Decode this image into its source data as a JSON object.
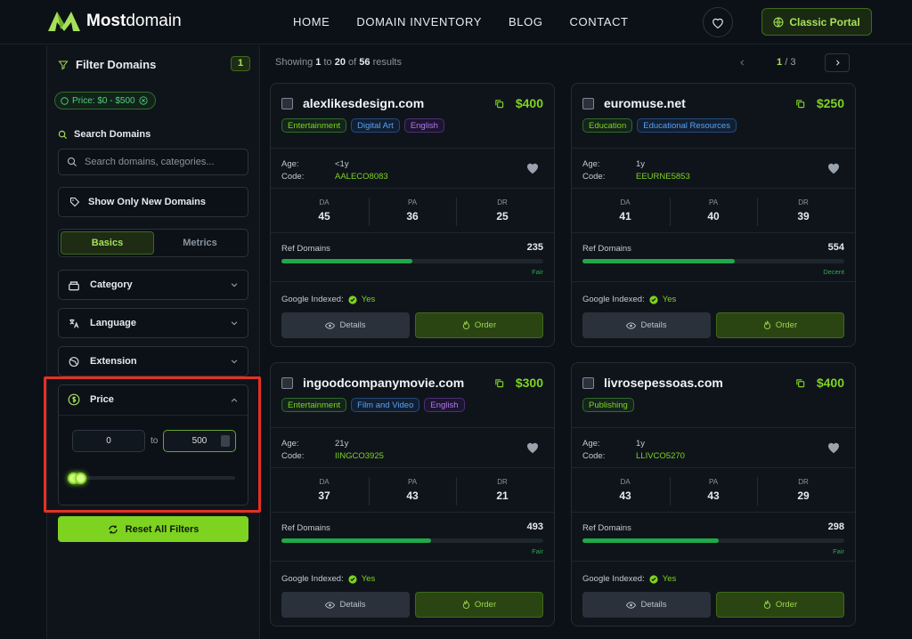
{
  "brand": {
    "name_bold": "Most",
    "name_rest": "domain"
  },
  "nav": {
    "items": [
      "HOME",
      "DOMAIN INVENTORY",
      "BLOG",
      "CONTACT"
    ],
    "portal_label": "Classic Portal"
  },
  "sidebar": {
    "title": "Filter Domains",
    "active_filter_count": "1",
    "price_chip": "Price: $0 - $500",
    "search_label": "Search Domains",
    "search_placeholder": "Search domains, categories...",
    "new_domains_label": "Show Only New Domains",
    "tabs": [
      "Basics",
      "Metrics"
    ],
    "active_tab": "Basics",
    "accordions": [
      "Category",
      "Language",
      "Extension"
    ],
    "price": {
      "label": "Price",
      "min": "0",
      "to_label": "to",
      "max": "500",
      "slider_min_fraction": 0,
      "slider_max_fraction": 0
    },
    "reset_label": "Reset All Filters"
  },
  "results": {
    "prefix": "Showing",
    "from": "1",
    "to_word": "to",
    "to": "20",
    "of_word": "of",
    "total": "56",
    "suffix": "results"
  },
  "pager": {
    "current": "1",
    "sep": "/",
    "total": "3"
  },
  "card_labels": {
    "age": "Age:",
    "code": "Code:",
    "da": "DA",
    "pa": "PA",
    "dr": "DR",
    "ref_domains": "Ref Domains",
    "google_indexed": "Google Indexed:",
    "details": "Details",
    "order": "Order"
  },
  "cards": [
    {
      "domain": "alexlikesdesign.com",
      "price": "$400",
      "tags": [
        {
          "label": "Entertainment",
          "color": "green"
        },
        {
          "label": "Digital Art",
          "color": "blue"
        },
        {
          "label": "English",
          "color": "purple"
        }
      ],
      "age": "<1y",
      "code": "AALECO8083",
      "da": "45",
      "pa": "36",
      "dr": "25",
      "ref_domains": "235",
      "ref_fraction": 0.5,
      "quality": "Fair",
      "indexed": "Yes"
    },
    {
      "domain": "euromuse.net",
      "price": "$250",
      "tags": [
        {
          "label": "Education",
          "color": "green"
        },
        {
          "label": "Educational Resources",
          "color": "blue"
        }
      ],
      "age": "1y",
      "code": "EEURNE5853",
      "da": "41",
      "pa": "40",
      "dr": "39",
      "ref_domains": "554",
      "ref_fraction": 0.58,
      "quality": "Decent",
      "indexed": "Yes"
    },
    {
      "domain": "ingoodcompanymovie.com",
      "price": "$300",
      "tags": [
        {
          "label": "Entertainment",
          "color": "green"
        },
        {
          "label": "Film and Video",
          "color": "blue"
        },
        {
          "label": "English",
          "color": "purple"
        }
      ],
      "age": "21y",
      "code": "IINGCO3925",
      "da": "37",
      "pa": "43",
      "dr": "21",
      "ref_domains": "493",
      "ref_fraction": 0.57,
      "quality": "Fair",
      "indexed": "Yes"
    },
    {
      "domain": "livrosepessoas.com",
      "price": "$400",
      "tags": [
        {
          "label": "Publishing",
          "color": "green"
        }
      ],
      "age": "1y",
      "code": "LLIVCO5270",
      "da": "43",
      "pa": "43",
      "dr": "29",
      "ref_domains": "298",
      "ref_fraction": 0.52,
      "quality": "Fair",
      "indexed": "Yes"
    }
  ],
  "colors": {
    "accent": "#7ed321",
    "background": "#0c1117",
    "highlight": "#e53025"
  },
  "icons": [
    "logo-mark-icon",
    "heart-icon",
    "globe-icon",
    "filter-icon",
    "search-icon",
    "tag-icon",
    "layers-icon",
    "translate-icon",
    "globe-ext-icon",
    "dollar-icon",
    "chevron-down-icon",
    "chevron-up-icon",
    "refresh-icon",
    "copy-icon",
    "eye-icon",
    "fire-icon",
    "check-circle-icon"
  ]
}
